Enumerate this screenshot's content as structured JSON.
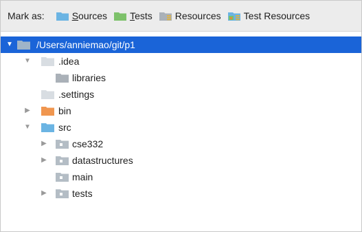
{
  "mark_bar": {
    "label": "Mark as:",
    "options": [
      {
        "pre": "",
        "underline": "S",
        "post": "ources",
        "icon": "sources-folder-icon",
        "color": "#6bb4e3"
      },
      {
        "pre": "",
        "underline": "T",
        "post": "ests",
        "icon": "tests-folder-icon",
        "color": "#7dc16a"
      },
      {
        "pre": "Resources",
        "underline": "",
        "post": "",
        "icon": "resources-folder-icon",
        "color": "#aab1b8"
      },
      {
        "pre": "Test Resources",
        "underline": "",
        "post": "",
        "icon": "test-resources-folder-icon",
        "color": "#6bb4e3"
      }
    ]
  },
  "tree": [
    {
      "label": "/Users/anniemao/git/p1",
      "depth": 0,
      "arrow": "expanded",
      "icon": "module-folder-icon",
      "selected": true
    },
    {
      "label": ".idea",
      "depth": 1,
      "arrow": "expanded",
      "icon": "plain-folder-icon",
      "selected": false
    },
    {
      "label": "libraries",
      "depth": 2,
      "arrow": "none",
      "icon": "gray-folder-icon",
      "selected": false
    },
    {
      "label": ".settings",
      "depth": 1,
      "arrow": "none",
      "icon": "plain-folder-icon",
      "selected": false
    },
    {
      "label": "bin",
      "depth": 1,
      "arrow": "collapsed",
      "icon": "excluded-folder-icon",
      "selected": false
    },
    {
      "label": "src",
      "depth": 1,
      "arrow": "expanded",
      "icon": "source-folder-icon",
      "selected": false
    },
    {
      "label": "cse332",
      "depth": 2,
      "arrow": "collapsed",
      "icon": "package-folder-icon",
      "selected": false
    },
    {
      "label": "datastructures",
      "depth": 2,
      "arrow": "collapsed",
      "icon": "package-folder-icon",
      "selected": false
    },
    {
      "label": "main",
      "depth": 2,
      "arrow": "none",
      "icon": "package-folder-icon",
      "selected": false
    },
    {
      "label": "tests",
      "depth": 2,
      "arrow": "collapsed",
      "icon": "package-folder-icon",
      "selected": false
    }
  ],
  "colors": {
    "selection": "#1a64d8",
    "sources": "#6bb4e3",
    "tests": "#7dc16a",
    "excluded": "#f0964f",
    "plain": "#d8dde2",
    "gray": "#aab1b8",
    "package": "#b4bdc5"
  }
}
